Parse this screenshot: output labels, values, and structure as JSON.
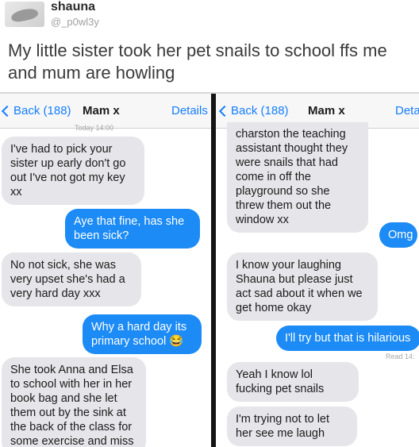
{
  "tweet": {
    "display_name": "shauna",
    "handle": "@_p0wl3y",
    "text": "My little sister took her pet snails to school ffs me and mum are howling"
  },
  "left_screen": {
    "nav": {
      "back": "Back (188)",
      "title": "Mam x",
      "details": "Details"
    },
    "timestamp": "Today 14:00",
    "messages": [
      {
        "dir": "in",
        "text": "I've had to pick your sister up early don't go out I've not got my key xx"
      },
      {
        "dir": "out",
        "text": "Aye that fine, has she been sick?"
      },
      {
        "dir": "in",
        "text": "No not sick, she was very upset she's had a very hard day xxx"
      },
      {
        "dir": "out",
        "text": "Why a hard day its primary school 😂"
      },
      {
        "dir": "in",
        "text": "She took Anna and Elsa to school with her in her book bag and she let them out by the sink at the back of the class for some exercise and miss"
      }
    ]
  },
  "right_screen": {
    "nav": {
      "back": "Back (188)",
      "title": "Mam x",
      "details": "Deta"
    },
    "read_receipt": "Read 14:",
    "messages": [
      {
        "dir": "in",
        "text": "charston the teaching assistant thought they were snails that had come in off the playground so she threw them out the window xx"
      },
      {
        "dir": "out",
        "text": "Omg"
      },
      {
        "dir": "in",
        "text": "I know your laughing Shauna but please just act sad about it when we get home okay"
      },
      {
        "dir": "out",
        "text": "I'll try but that is hilarious"
      },
      {
        "dir": "in",
        "text": "Yeah I know lol fucking pet snails"
      },
      {
        "dir": "in",
        "text": "I'm trying not to let her see me laugh"
      }
    ]
  },
  "colors": {
    "ios_blue": "#147efb",
    "bubble_out": "#1c8bf5",
    "bubble_in": "#e5e5ea"
  },
  "icons": {
    "back": "chevron-left-icon",
    "avatar": "profile-avatar"
  }
}
